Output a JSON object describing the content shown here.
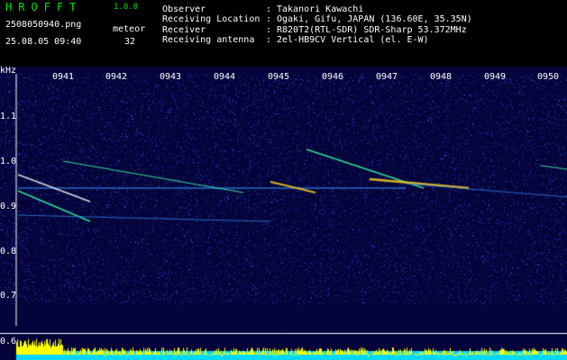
{
  "header": {
    "brand": "HROFFT",
    "version": "1.0.0",
    "filename": "2508050940.png",
    "mode_label": "meteor",
    "datetime": "25.08.05 09:40",
    "count": "32",
    "info": [
      {
        "key": "Observer",
        "value": "Takanori Kawachi"
      },
      {
        "key": "Receiving Location",
        "value": "Ogaki, Gifu, JAPAN (136.60E, 35.35N)"
      },
      {
        "key": "Receiver",
        "value": "R820T2(RTL-SDR) SDR-Sharp 53.372MHz"
      },
      {
        "key": "Receiving antenna",
        "value": "2el-HB9CV Vertical (el. E-W)"
      }
    ]
  },
  "axis": {
    "unit": "kHz",
    "freq_ticks": [
      "1.1",
      "1.0",
      "0.9",
      "0.8",
      "0.7",
      "0.6"
    ],
    "time_ticks": [
      "0941",
      "0942",
      "0943",
      "0944",
      "0945",
      "0946",
      "0947",
      "0948",
      "0949",
      "0950"
    ]
  },
  "colors": {
    "background": "#04043a",
    "trail": "#3cff9e",
    "trail_hot": "#ffd020",
    "header_green": "#00e000",
    "level_bar": "#ffff00",
    "level_base": "#00d8ff"
  }
}
